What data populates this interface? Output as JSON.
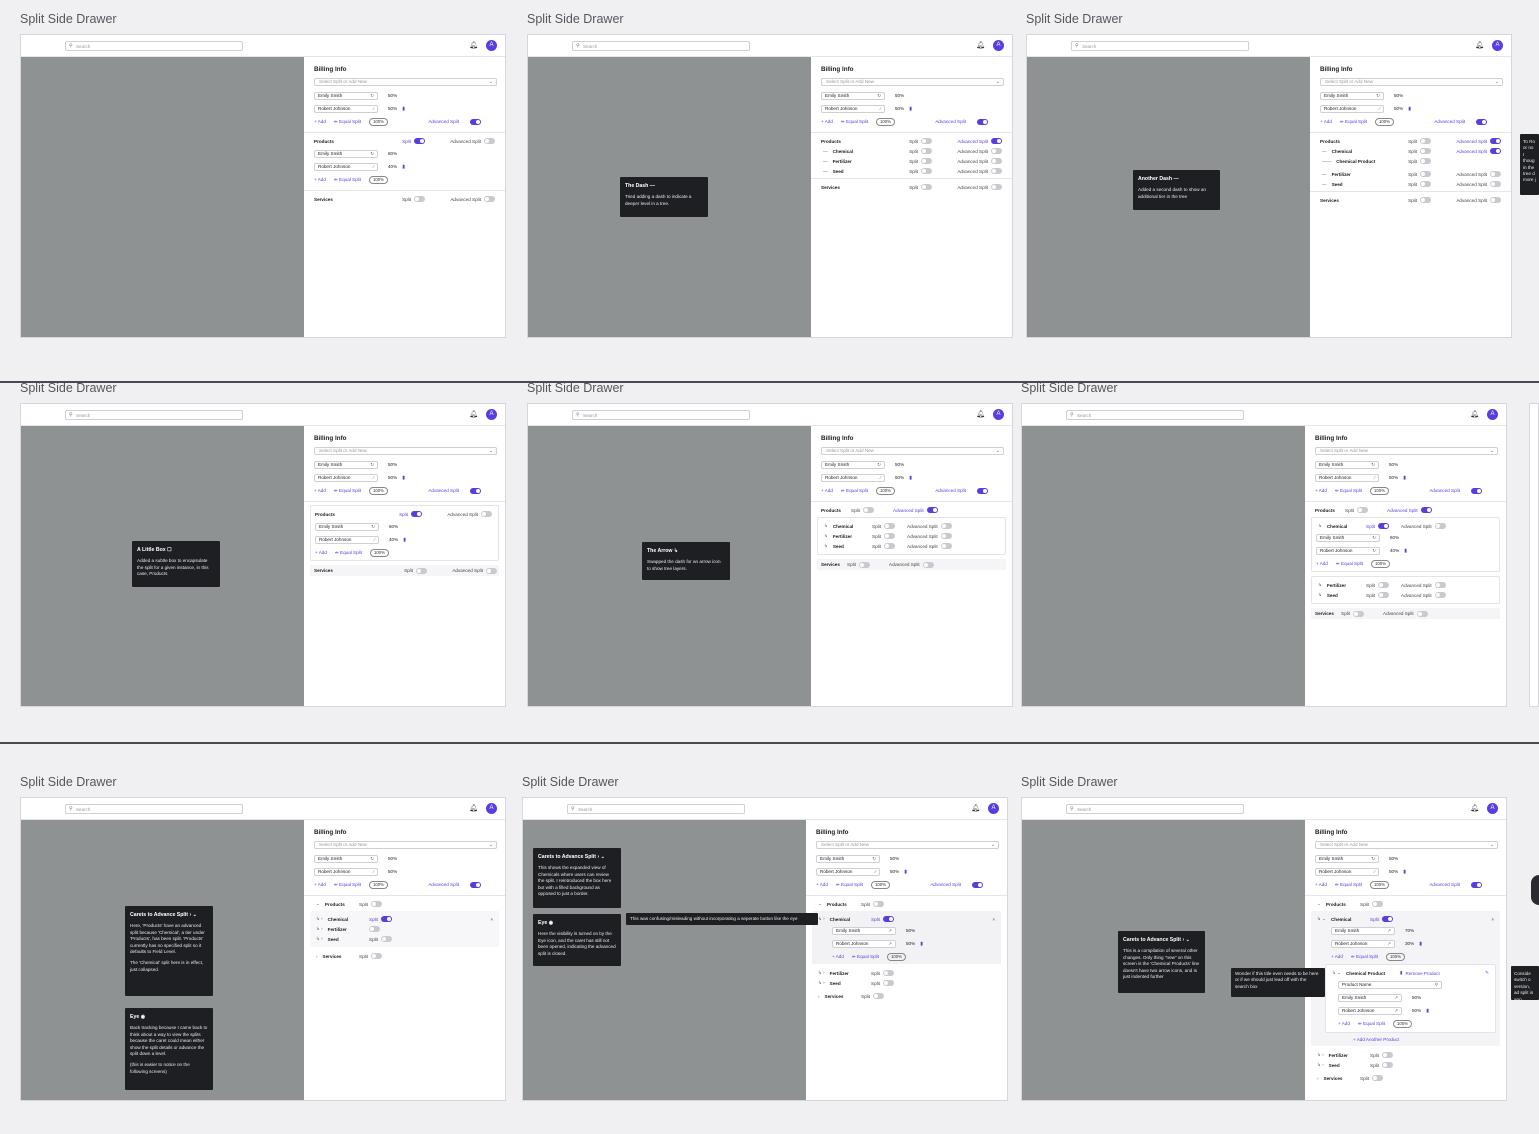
{
  "frame_title": "Split Side Drawer",
  "common": {
    "search_placeholder": "Search",
    "avatar_initial": "A",
    "billing_title": "Billing Info",
    "select_placeholder": "Select Split or Add New",
    "person1": "Emily Smith",
    "person2": "Robert Johnson",
    "pct50": "50%",
    "pct60": "60%",
    "pct40": "40%",
    "pct70": "70%",
    "pct30": "30%",
    "add": "+ Add",
    "equal_split": "⇹ Equal Split",
    "total": "100%",
    "advanced_split": "Advanced Split",
    "split": "Split",
    "products": "Products",
    "services": "Services",
    "chemical": "Chemical",
    "fertilizer": "Fertilizer",
    "seed": "Seed",
    "chemical_product": "Chemical Product",
    "product_name": "Product Name",
    "remove_product": "Remove Product",
    "add_another_product": "+ Add Another Product"
  },
  "notes": {
    "dash": {
      "title": "The Dash —",
      "body": "Tried adding a dash to indicate a deeper level in a tree."
    },
    "another_dash": {
      "title": "Another Dash —",
      "body": "Added a second dash to show an additional tier in the tree"
    },
    "little_box": {
      "title": "A Little Box",
      "body": "Added a subtle box to encapsulate the split for a given instance, in this case, Products"
    },
    "arrow": {
      "title": "The Arrow",
      "body": "Swapped the dash for an arrow icon to show tree layers."
    },
    "carets1": {
      "title": "Carets to Advance Split",
      "body1": "Here, 'Products' have an advanced split because 'Chemical', a tier under 'Products', has been split. 'Products' currently has no specified split so it defaults to Field Level.",
      "body2": "The 'Chemical' split here is in effect, just collapsed."
    },
    "eye1": {
      "title": "Eye",
      "body1": "Back tracking because I came back to think about a way to view the splits because the caret could mean either show the split details or advance the split down a level.",
      "body2": "(this is easier to notice on the following screens)"
    },
    "carets2": {
      "title": "Carets to Advance Split",
      "body": "This shows the expanded view of Chemicals where users can review the split. I reintroduced the box here but with a filled background as opposed to just a border."
    },
    "eye2": {
      "title": "Eye",
      "body": "Here the visibility is turned on by the Eye icon, and the caret has still not been opened, indicating the advanced split is closed."
    },
    "confusing": {
      "body": "This was confusing/misleading without incorporating a seperate button like the eye"
    },
    "carets3": {
      "title": "Carets to Advance Split",
      "body": "This is a compilation of several other changes. Only thing \"new\" on this screen is the 'Chemical Products' line doesn't have two arrow icons, and is just indented further"
    },
    "wonder": {
      "body": "Wonder if this title even needs to be here or if we should just lead off with the search box"
    },
    "edge1": {
      "body": "To Ro or no I thoug in the tree d more j"
    },
    "edge2": {
      "body": "Conside switch o version, ad split is app"
    }
  }
}
